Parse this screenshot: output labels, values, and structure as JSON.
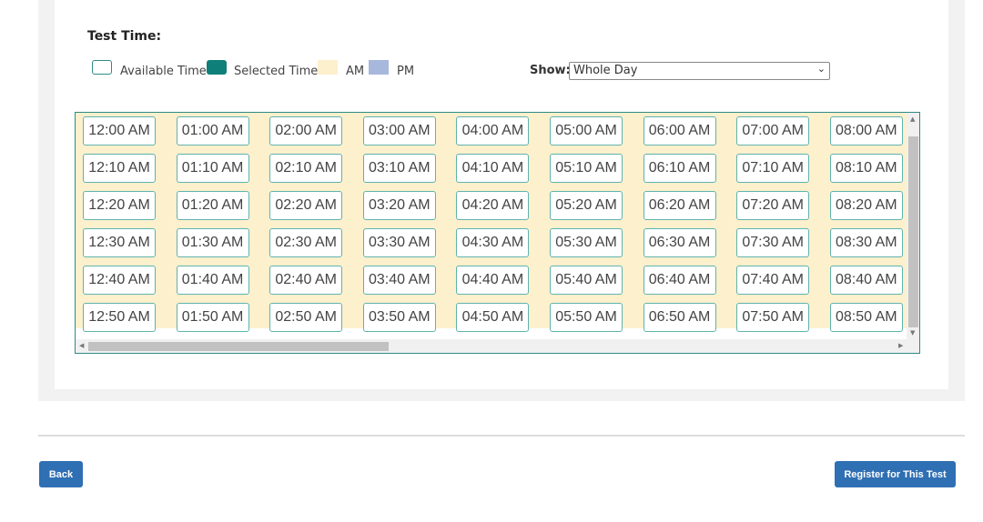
{
  "test_time": {
    "title": "Test Time:"
  },
  "legend": {
    "available": "Available Time",
    "selected": "Selected Time",
    "am": "AM",
    "pm": "PM"
  },
  "colors": {
    "available_border": "#2e8b86",
    "selected": "#0f7f7a",
    "am": "#fdf0cd",
    "pm": "#a7b8dc",
    "button": "#2f6fb3"
  },
  "show": {
    "label": "Show:",
    "value": "Whole Day"
  },
  "time_slots": [
    [
      "12:00 AM",
      "01:00 AM",
      "02:00 AM",
      "03:00 AM",
      "04:00 AM",
      "05:00 AM",
      "06:00 AM",
      "07:00 AM",
      "08:00 AM"
    ],
    [
      "12:10 AM",
      "01:10 AM",
      "02:10 AM",
      "03:10 AM",
      "04:10 AM",
      "05:10 AM",
      "06:10 AM",
      "07:10 AM",
      "08:10 AM"
    ],
    [
      "12:20 AM",
      "01:20 AM",
      "02:20 AM",
      "03:20 AM",
      "04:20 AM",
      "05:20 AM",
      "06:20 AM",
      "07:20 AM",
      "08:20 AM"
    ],
    [
      "12:30 AM",
      "01:30 AM",
      "02:30 AM",
      "03:30 AM",
      "04:30 AM",
      "05:30 AM",
      "06:30 AM",
      "07:30 AM",
      "08:30 AM"
    ],
    [
      "12:40 AM",
      "01:40 AM",
      "02:40 AM",
      "03:40 AM",
      "04:40 AM",
      "05:40 AM",
      "06:40 AM",
      "07:40 AM",
      "08:40 AM"
    ],
    [
      "12:50 AM",
      "01:50 AM",
      "02:50 AM",
      "03:50 AM",
      "04:50 AM",
      "05:50 AM",
      "06:50 AM",
      "07:50 AM",
      "08:50 AM"
    ]
  ],
  "buttons": {
    "back": "Back",
    "register": "Register for This Test"
  }
}
